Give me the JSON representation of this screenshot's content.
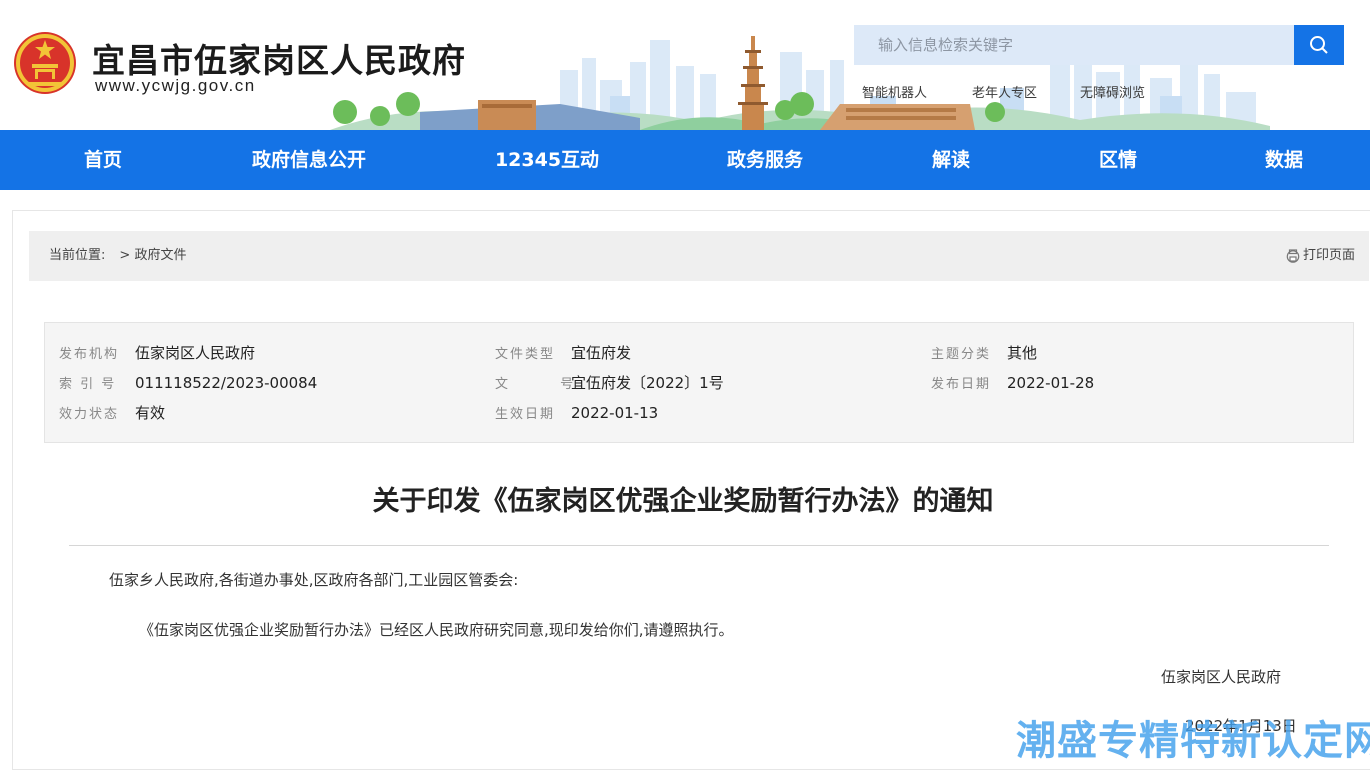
{
  "header": {
    "site_title": "宜昌市伍家岗区人民政府",
    "site_url": "www.ycwjg.gov.cn",
    "search_placeholder": "输入信息检索关键字",
    "quick_links": [
      "智能机器人",
      "老年人专区",
      "无障碍浏览"
    ]
  },
  "nav": {
    "items": [
      "首页",
      "政府信息公开",
      "12345互动",
      "政务服务",
      "解读",
      "区情",
      "数据"
    ]
  },
  "breadcrumb": {
    "label": "当前位置:",
    "current": "政府文件",
    "print_label": "打印页面"
  },
  "meta": {
    "publisher_label": "发布机构",
    "publisher": "伍家岗区人民政府",
    "doc_type_label": "文件类型",
    "doc_type": "宜伍府发",
    "topic_label": "主题分类",
    "topic": "其他",
    "index_label": "索 引 号",
    "index": "011118522/2023-00084",
    "doc_no_label": "文 号",
    "doc_no": "宜伍府发〔2022〕1号",
    "publish_date_label": "发布日期",
    "publish_date": "2022-01-28",
    "status_label": "效力状态",
    "status": "有效",
    "effective_date_label": "生效日期",
    "effective_date": "2022-01-13"
  },
  "document": {
    "title": "关于印发《伍家岗区优强企业奖励暂行办法》的通知",
    "salutation": "伍家乡人民政府,各街道办事处,区政府各部门,工业园区管委会:",
    "body": "《伍家岗区优强企业奖励暂行办法》已经区人民政府研究同意,现印发给你们,请遵照执行。",
    "signature": "伍家岗区人民政府",
    "date": "2022年1月13日"
  },
  "watermark": "潮盛专精特新认定网",
  "colors": {
    "brand_blue": "#1473e6",
    "search_bg": "#dde9f8",
    "crumb_bg": "#efefef",
    "meta_bg": "#f5f5f5"
  }
}
